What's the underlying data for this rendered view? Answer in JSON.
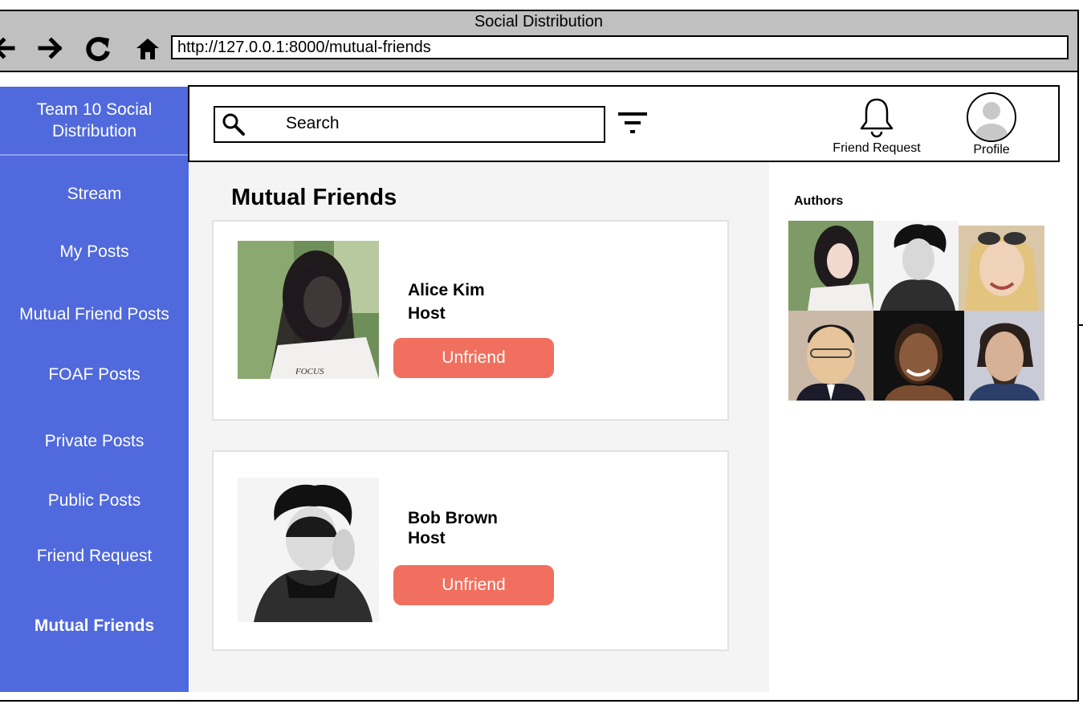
{
  "window": {
    "title": "Social Distribution"
  },
  "browser": {
    "url": "http://127.0.0.1:8000/mutual-friends",
    "icons": [
      "back-arrow-icon",
      "forward-arrow-icon",
      "reload-icon",
      "home-icon"
    ]
  },
  "sidebar": {
    "title": "Team 10 Social Distribution",
    "items": [
      {
        "label": "Stream",
        "active": false
      },
      {
        "label": "My Posts",
        "active": false
      },
      {
        "label": "Mutual Friend Posts",
        "active": false
      },
      {
        "label": "FOAF Posts",
        "active": false
      },
      {
        "label": "Private Posts",
        "active": false
      },
      {
        "label": "Public Posts",
        "active": false
      },
      {
        "label": "Friend Request",
        "active": false
      },
      {
        "label": "Mutual Friends",
        "active": true
      }
    ]
  },
  "topbar": {
    "search_placeholder": "Search",
    "friend_request_label": "Friend Request",
    "profile_label": "Profile"
  },
  "main": {
    "title": "Mutual Friends",
    "friends": [
      {
        "name": "Alice Kim",
        "host": "Host",
        "button_label": "Unfriend"
      },
      {
        "name": "Bob Brown",
        "host": "Host",
        "button_label": "Unfriend"
      }
    ]
  },
  "authors": {
    "title": "Authors",
    "count": 6
  },
  "colors": {
    "sidebar": "#5069dc",
    "unfriend_button": "#f16f5e",
    "browser_chrome": "#c0c0c0",
    "content_bg": "#f4f4f4"
  }
}
